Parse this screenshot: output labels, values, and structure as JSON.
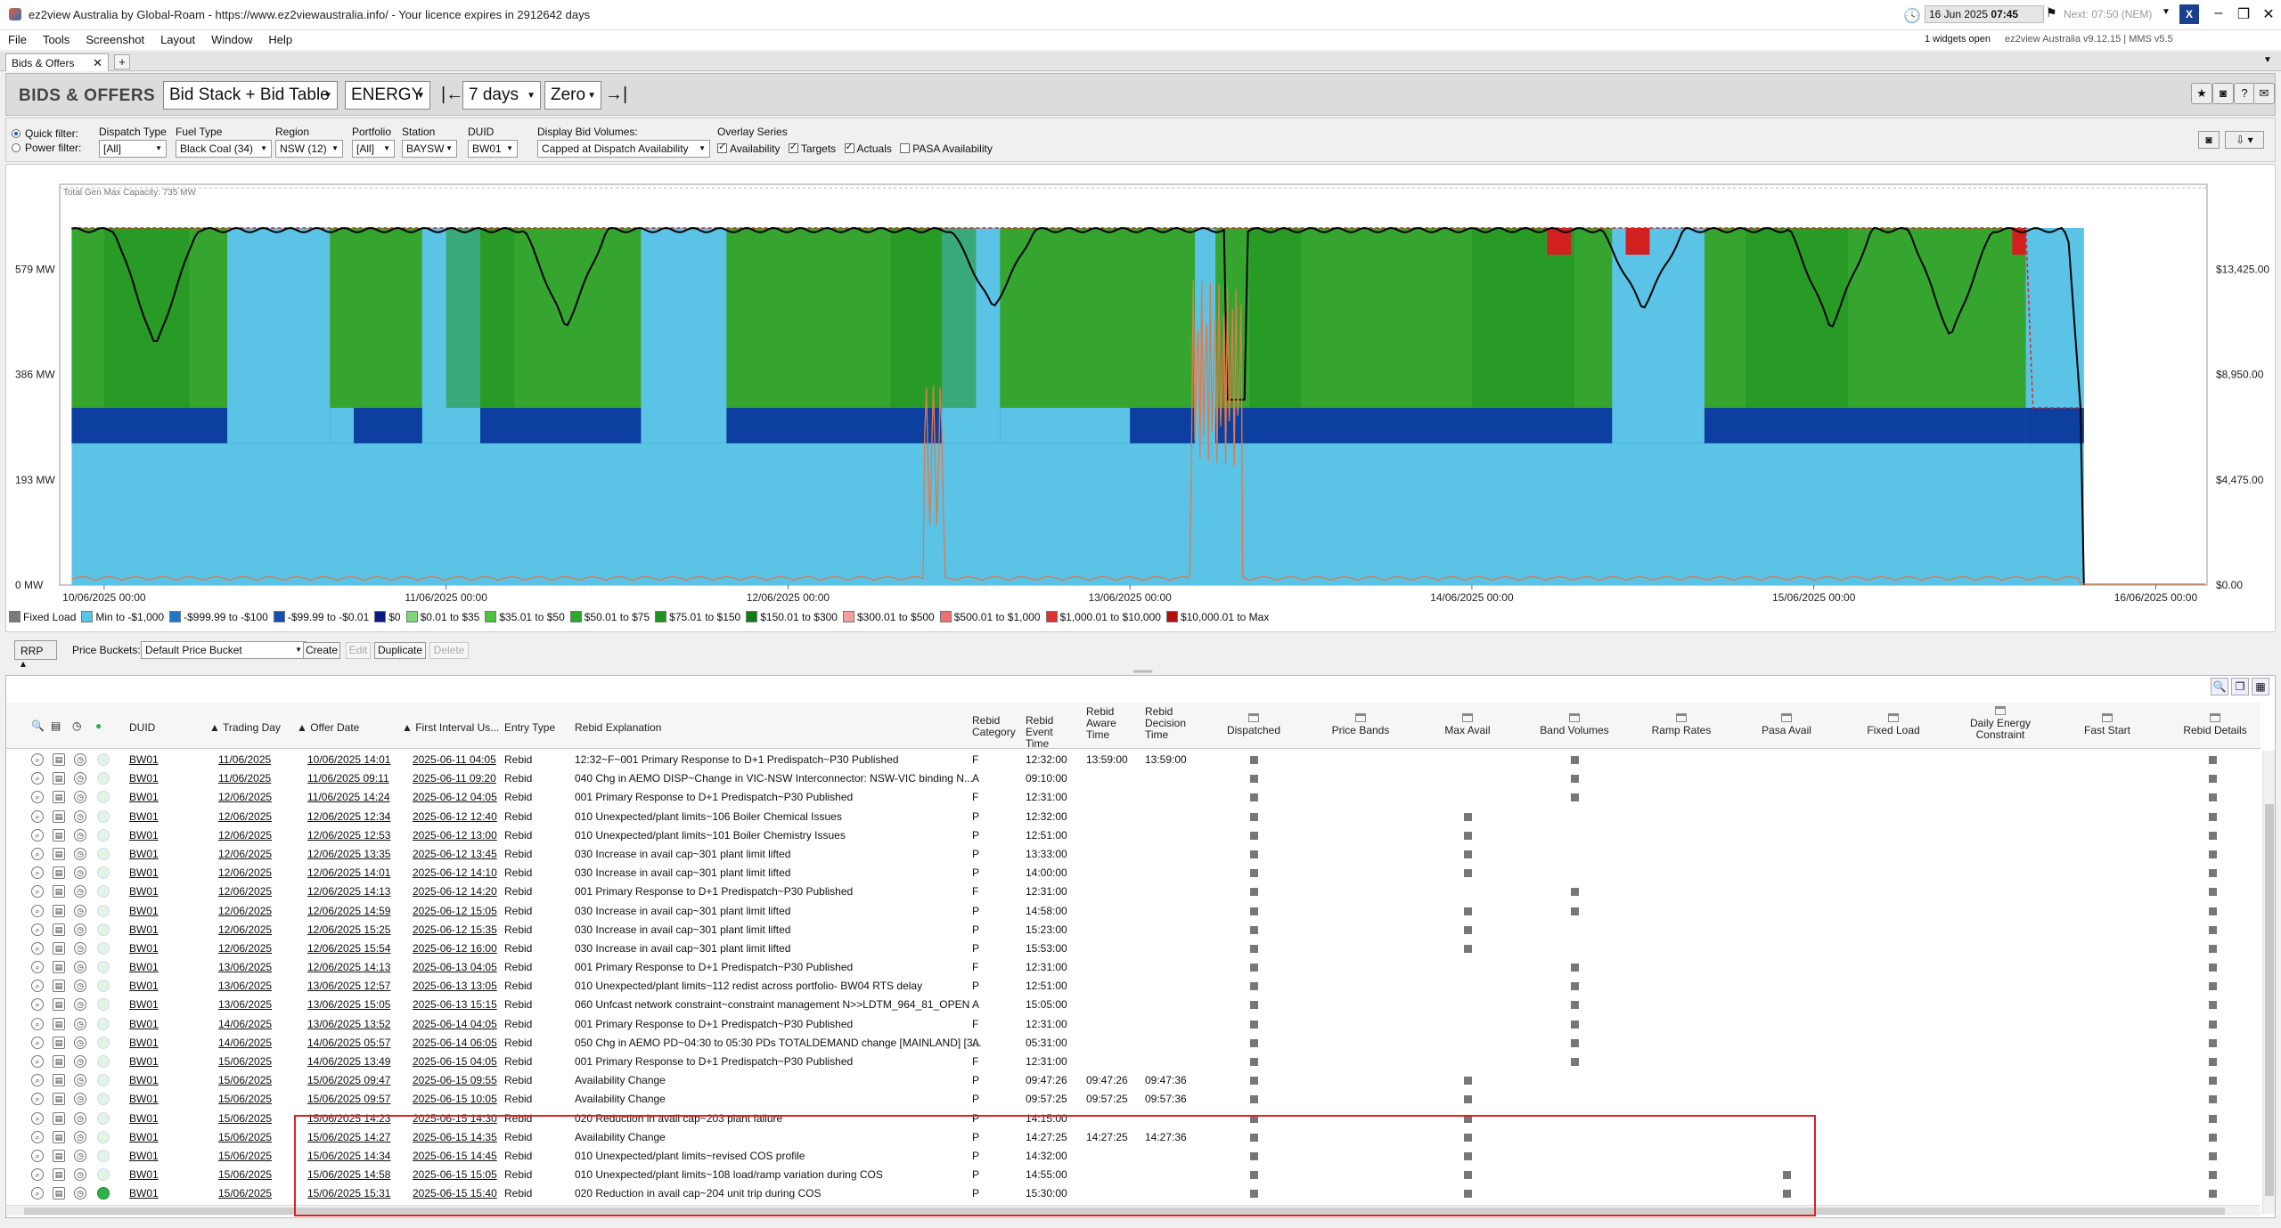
{
  "window": {
    "title": "ez2view Australia by Global-Roam - https://www.ez2viewaustralia.info/ - Your licence expires in 2912642 days",
    "date": "16 Jun 2025",
    "time": "07:45",
    "next": "Next: 07:50 (NEM)",
    "logo": "X",
    "widgets_open": "1 widgets open",
    "version": "ez2view Australia v9.12.15 | MMS v5.5"
  },
  "menu": [
    "File",
    "Tools",
    "Screenshot",
    "Layout",
    "Window",
    "Help"
  ],
  "tab": {
    "label": "Bids & Offers",
    "close": "✕",
    "plus": "+"
  },
  "toolbar": {
    "heading": "BIDS & OFFERS",
    "view": "Bid Stack + Bid Table",
    "commodity": "ENERGY",
    "period": "7 days",
    "baseline": "Zero",
    "nav_start": "|←",
    "nav_end": "→|"
  },
  "filters": {
    "quick_filter": "Quick filter:",
    "power_filter": "Power filter:",
    "dispatch_type": {
      "label": "Dispatch Type",
      "value": "[All]"
    },
    "fuel_type": {
      "label": "Fuel Type",
      "value": "Black Coal (34)"
    },
    "region": {
      "label": "Region",
      "value": "NSW (12)"
    },
    "portfolio": {
      "label": "Portfolio",
      "value": "[All]"
    },
    "station": {
      "label": "Station",
      "value": "BAYSW"
    },
    "duid": {
      "label": "DUID",
      "value": "BW01"
    },
    "display_bid_volumes": {
      "label": "Display Bid Volumes:",
      "value": "Capped at Dispatch Availability"
    },
    "overlay": {
      "label": "Overlay Series",
      "items": [
        {
          "label": "Availability",
          "checked": true
        },
        {
          "label": "Targets",
          "checked": true
        },
        {
          "label": "Actuals",
          "checked": true
        },
        {
          "label": "PASA Availability",
          "checked": false
        }
      ]
    }
  },
  "chart_data": {
    "type": "area",
    "title": "Total Gen Max Capacity: 735 MW",
    "y_left_ticks": [
      "579 MW",
      "386 MW",
      "193 MW",
      "0 MW"
    ],
    "y_left_values": [
      579,
      386,
      193,
      0
    ],
    "ylim_left": [
      0,
      735
    ],
    "y_right_ticks": [
      "$13,425.00",
      "$8,950.00",
      "$4,475.00",
      "$0.00"
    ],
    "y_right_values": [
      13425,
      8950,
      4475,
      0
    ],
    "x_ticks": [
      "10/06/2025 00:00",
      "11/06/2025 00:00",
      "12/06/2025 00:00",
      "13/06/2025 00:00",
      "14/06/2025 00:00",
      "15/06/2025 00:00",
      "16/06/2025 00:00"
    ],
    "x_range_days": [
      9.87,
      16.15
    ],
    "bands": [
      {
        "name": "Min to -$1,000",
        "color": "#5bc3e6",
        "mw": 260
      },
      {
        "name": "$0.01 to $35",
        "color": "#0c3fa0",
        "mw": 65
      },
      {
        "name": "$150.01 to $300",
        "color": "#36a530",
        "mw": 330
      }
    ],
    "legend": [
      {
        "label": "Fixed Load",
        "color": "#7a7a7a"
      },
      {
        "label": "Min to -$1,000",
        "color": "#5bc3e6"
      },
      {
        "label": "-$999.99 to -$100",
        "color": "#1f78c8"
      },
      {
        "label": "-$99.99 to -$0.01",
        "color": "#1450b0"
      },
      {
        "label": "$0",
        "color": "#0a1a80"
      },
      {
        "label": "$0.01 to $35",
        "color": "#7ed87a"
      },
      {
        "label": "$35.01 to $50",
        "color": "#50c040"
      },
      {
        "label": "$50.01 to $75",
        "color": "#2ea82a"
      },
      {
        "label": "$75.01 to $150",
        "color": "#1e9420"
      },
      {
        "label": "$150.01 to $300",
        "color": "#117a18"
      },
      {
        "label": "$300.01 to $500",
        "color": "#f4a0a0"
      },
      {
        "label": "$500.01 to $1,000",
        "color": "#ee7070"
      },
      {
        "label": "$1,000.01 to $10,000",
        "color": "#e03030"
      },
      {
        "label": "$10,000.01 to Max",
        "color": "#b01010"
      }
    ]
  },
  "pricebar": {
    "rrp": "RRP ▴",
    "label": "Price Buckets:",
    "bucket": "Default Price Bucket",
    "create": "Create",
    "edit": "Edit",
    "duplicate": "Duplicate",
    "delete": "Delete"
  },
  "table": {
    "headers": {
      "duid": "DUID",
      "trading_day": "Trading Day",
      "offer_date": "Offer Date",
      "first_interval": "First Interval Us...",
      "entry_type": "Entry Type",
      "rebid_explanation": "Rebid Explanation",
      "rebid_category": "Rebid Category",
      "rebid_event_time": "Rebid Event Time",
      "rebid_aware_time": "Rebid Aware Time",
      "rebid_decision_time": "Rebid Decision Time",
      "dispatched": "Dispatched",
      "price_bands": "Price Bands",
      "max_avail": "Max Avail",
      "band_volumes": "Band Volumes",
      "ramp_rates": "Ramp Rates",
      "pasa_avail": "Pasa Avail",
      "fixed_load": "Fixed Load",
      "daily_energy": "Daily Energy Constraint",
      "fast_start": "Fast Start",
      "rebid_details": "Rebid Details"
    },
    "rows": [
      {
        "duid": "BW01",
        "day": "11/06/2025",
        "offer": "10/06/2025 14:01",
        "first": "2025-06-11 04:05",
        "entry": "Rebid",
        "expl": "12:32~F~001 Primary Response to D+1 Predispatch~P30 Published",
        "cat": "F",
        "event": "12:32:00",
        "aware": "13:59:00",
        "decision": "13:59:00",
        "max": false,
        "band": true,
        "pasa": false,
        "active": false
      },
      {
        "duid": "BW01",
        "day": "11/06/2025",
        "offer": "11/06/2025 09:11",
        "first": "2025-06-11 09:20",
        "entry": "Rebid",
        "expl": "040 Chg in AEMO DISP~Change in VIC-NSW Interconnector: NSW-VIC binding N...",
        "cat": "A",
        "event": "09:10:00",
        "aware": "",
        "decision": "",
        "max": false,
        "band": true,
        "pasa": false,
        "active": false
      },
      {
        "duid": "BW01",
        "day": "12/06/2025",
        "offer": "11/06/2025 14:24",
        "first": "2025-06-12 04:05",
        "entry": "Rebid",
        "expl": "001 Primary Response to D+1 Predispatch~P30 Published",
        "cat": "F",
        "event": "12:31:00",
        "aware": "",
        "decision": "",
        "max": false,
        "band": true,
        "pasa": false,
        "active": false
      },
      {
        "duid": "BW01",
        "day": "12/06/2025",
        "offer": "12/06/2025 12:34",
        "first": "2025-06-12 12:40",
        "entry": "Rebid",
        "expl": "010 Unexpected/plant limits~106 Boiler Chemical Issues",
        "cat": "P",
        "event": "12:32:00",
        "aware": "",
        "decision": "",
        "max": true,
        "band": false,
        "pasa": false,
        "active": false
      },
      {
        "duid": "BW01",
        "day": "12/06/2025",
        "offer": "12/06/2025 12:53",
        "first": "2025-06-12 13:00",
        "entry": "Rebid",
        "expl": "010 Unexpected/plant limits~101 Boiler Chemistry Issues",
        "cat": "P",
        "event": "12:51:00",
        "aware": "",
        "decision": "",
        "max": true,
        "band": false,
        "pasa": false,
        "active": false
      },
      {
        "duid": "BW01",
        "day": "12/06/2025",
        "offer": "12/06/2025 13:35",
        "first": "2025-06-12 13:45",
        "entry": "Rebid",
        "expl": "030 Increase in avail cap~301 plant limit lifted",
        "cat": "P",
        "event": "13:33:00",
        "aware": "",
        "decision": "",
        "max": true,
        "band": false,
        "pasa": false,
        "active": false
      },
      {
        "duid": "BW01",
        "day": "12/06/2025",
        "offer": "12/06/2025 14:01",
        "first": "2025-06-12 14:10",
        "entry": "Rebid",
        "expl": "030 Increase in avail cap~301 plant limit lifted",
        "cat": "P",
        "event": "14:00:00",
        "aware": "",
        "decision": "",
        "max": true,
        "band": false,
        "pasa": false,
        "active": false
      },
      {
        "duid": "BW01",
        "day": "12/06/2025",
        "offer": "12/06/2025 14:13",
        "first": "2025-06-12 14:20",
        "entry": "Rebid",
        "expl": "001 Primary Response to D+1 Predispatch~P30 Published",
        "cat": "F",
        "event": "12:31:00",
        "aware": "",
        "decision": "",
        "max": false,
        "band": true,
        "pasa": false,
        "active": false
      },
      {
        "duid": "BW01",
        "day": "12/06/2025",
        "offer": "12/06/2025 14:59",
        "first": "2025-06-12 15:05",
        "entry": "Rebid",
        "expl": "030 Increase in avail cap~301 plant limit lifted",
        "cat": "P",
        "event": "14:58:00",
        "aware": "",
        "decision": "",
        "max": true,
        "band": true,
        "pasa": false,
        "active": false
      },
      {
        "duid": "BW01",
        "day": "12/06/2025",
        "offer": "12/06/2025 15:25",
        "first": "2025-06-12 15:35",
        "entry": "Rebid",
        "expl": "030 Increase in avail cap~301 plant limit lifted",
        "cat": "P",
        "event": "15:23:00",
        "aware": "",
        "decision": "",
        "max": true,
        "band": false,
        "pasa": false,
        "active": false
      },
      {
        "duid": "BW01",
        "day": "12/06/2025",
        "offer": "12/06/2025 15:54",
        "first": "2025-06-12 16:00",
        "entry": "Rebid",
        "expl": "030 Increase in avail cap~301 plant limit lifted",
        "cat": "P",
        "event": "15:53:00",
        "aware": "",
        "decision": "",
        "max": true,
        "band": false,
        "pasa": false,
        "active": false
      },
      {
        "duid": "BW01",
        "day": "13/06/2025",
        "offer": "12/06/2025 14:13",
        "first": "2025-06-13 04:05",
        "entry": "Rebid",
        "expl": "001 Primary Response to D+1 Predispatch~P30 Published",
        "cat": "F",
        "event": "12:31:00",
        "aware": "",
        "decision": "",
        "max": false,
        "band": true,
        "pasa": false,
        "active": false
      },
      {
        "duid": "BW01",
        "day": "13/06/2025",
        "offer": "13/06/2025 12:57",
        "first": "2025-06-13 13:05",
        "entry": "Rebid",
        "expl": "010 Unexpected/plant limits~112 redist across portfolio- BW04 RTS delay",
        "cat": "P",
        "event": "12:51:00",
        "aware": "",
        "decision": "",
        "max": false,
        "band": true,
        "pasa": false,
        "active": false
      },
      {
        "duid": "BW01",
        "day": "13/06/2025",
        "offer": "13/06/2025 15:05",
        "first": "2025-06-13 15:15",
        "entry": "Rebid",
        "expl": "060 Unfcast network constraint~constraint management N>>LDTM_964_81_OPEN",
        "cat": "A",
        "event": "15:05:00",
        "aware": "",
        "decision": "",
        "max": false,
        "band": true,
        "pasa": false,
        "active": false
      },
      {
        "duid": "BW01",
        "day": "14/06/2025",
        "offer": "13/06/2025 13:52",
        "first": "2025-06-14 04:05",
        "entry": "Rebid",
        "expl": "001 Primary Response to D+1 Predispatch~P30 Published",
        "cat": "F",
        "event": "12:31:00",
        "aware": "",
        "decision": "",
        "max": false,
        "band": true,
        "pasa": false,
        "active": false
      },
      {
        "duid": "BW01",
        "day": "14/06/2025",
        "offer": "14/06/2025 05:57",
        "first": "2025-06-14 06:05",
        "entry": "Rebid",
        "expl": "050 Chg in AEMO PD~04:30 to 05:30 PDs TOTALDEMAND change [MAINLAND] [3...",
        "cat": "A",
        "event": "05:31:00",
        "aware": "",
        "decision": "",
        "max": false,
        "band": true,
        "pasa": false,
        "active": false
      },
      {
        "duid": "BW01",
        "day": "15/06/2025",
        "offer": "14/06/2025 13:49",
        "first": "2025-06-15 04:05",
        "entry": "Rebid",
        "expl": "001 Primary Response to D+1 Predispatch~P30 Published",
        "cat": "F",
        "event": "12:31:00",
        "aware": "",
        "decision": "",
        "max": false,
        "band": true,
        "pasa": false,
        "active": false
      },
      {
        "duid": "BW01",
        "day": "15/06/2025",
        "offer": "15/06/2025 09:47",
        "first": "2025-06-15 09:55",
        "entry": "Rebid",
        "expl": "Availability Change",
        "cat": "P",
        "event": "09:47:26",
        "aware": "09:47:26",
        "decision": "09:47:36",
        "max": true,
        "band": false,
        "pasa": false,
        "active": false
      },
      {
        "duid": "BW01",
        "day": "15/06/2025",
        "offer": "15/06/2025 09:57",
        "first": "2025-06-15 10:05",
        "entry": "Rebid",
        "expl": "Availability Change",
        "cat": "P",
        "event": "09:57:25",
        "aware": "09:57:25",
        "decision": "09:57:36",
        "max": true,
        "band": false,
        "pasa": false,
        "active": false
      },
      {
        "duid": "BW01",
        "day": "15/06/2025",
        "offer": "15/06/2025 14:23",
        "first": "2025-06-15 14:30",
        "entry": "Rebid",
        "expl": "020 Reduction in avail cap~203 plant failure",
        "cat": "P",
        "event": "14:15:00",
        "aware": "",
        "decision": "",
        "max": true,
        "band": false,
        "pasa": false,
        "active": false
      },
      {
        "duid": "BW01",
        "day": "15/06/2025",
        "offer": "15/06/2025 14:27",
        "first": "2025-06-15 14:35",
        "entry": "Rebid",
        "expl": "Availability Change",
        "cat": "P",
        "event": "14:27:25",
        "aware": "14:27:25",
        "decision": "14:27:36",
        "max": true,
        "band": false,
        "pasa": false,
        "active": false
      },
      {
        "duid": "BW01",
        "day": "15/06/2025",
        "offer": "15/06/2025 14:34",
        "first": "2025-06-15 14:45",
        "entry": "Rebid",
        "expl": "010 Unexpected/plant limits~revised COS profile",
        "cat": "P",
        "event": "14:32:00",
        "aware": "",
        "decision": "",
        "max": true,
        "band": false,
        "pasa": false,
        "active": false
      },
      {
        "duid": "BW01",
        "day": "15/06/2025",
        "offer": "15/06/2025 14:58",
        "first": "2025-06-15 15:05",
        "entry": "Rebid",
        "expl": "010 Unexpected/plant limits~108 load/ramp variation during COS",
        "cat": "P",
        "event": "14:55:00",
        "aware": "",
        "decision": "",
        "max": true,
        "band": false,
        "pasa": true,
        "active": false
      },
      {
        "duid": "BW01",
        "day": "15/06/2025",
        "offer": "15/06/2025 15:31",
        "first": "2025-06-15 15:40",
        "entry": "Rebid",
        "expl": "020 Reduction in avail cap~204 unit trip during COS",
        "cat": "P",
        "event": "15:30:00",
        "aware": "",
        "decision": "",
        "max": true,
        "band": false,
        "pasa": true,
        "active": true
      }
    ]
  }
}
